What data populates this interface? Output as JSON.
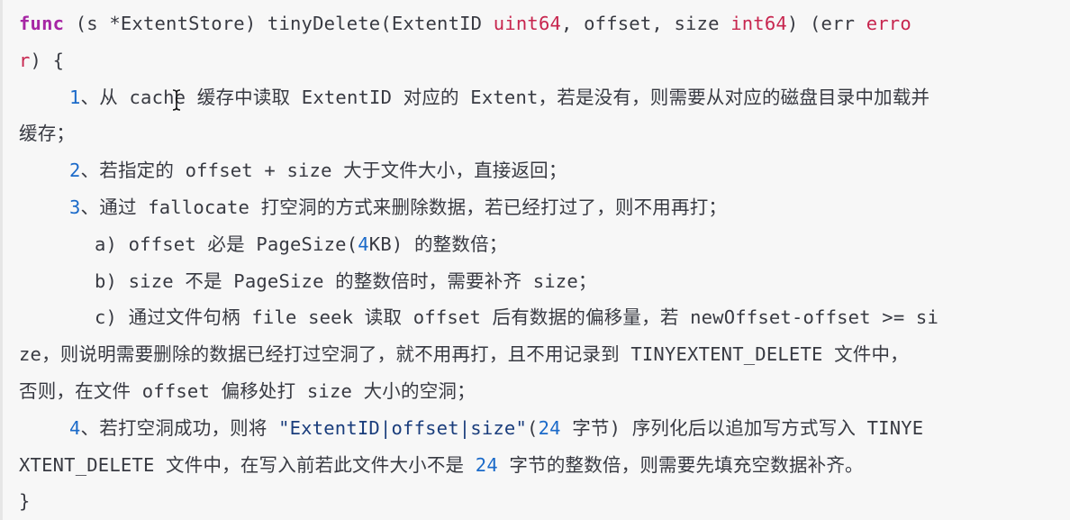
{
  "code": {
    "header": {
      "keyword": "func",
      "receiver": " (s *ExtentStore) tinyDelete(ExtentID ",
      "t1": "uint64",
      "mid1": ", offset, size ",
      "t2": "int64",
      "mid2": ") (err ",
      "t3": "erro"
    },
    "header_cont": {
      "t3_tail": "r",
      "rest": ") {"
    },
    "lines": [
      {
        "num": "1",
        "text": "、从 cache 缓存中读取 ExtentID 对应的 Extent，若是没有，则需要从对应的磁盘目录中加载并"
      },
      {
        "text": "缓存；"
      },
      {
        "num": "2",
        "text": "、若指定的 offset + size 大于文件大小，直接返回；"
      },
      {
        "num": "3",
        "text": "、通过 fallocate 打空洞的方式来删除数据，若已经打过了，则不用再打；"
      },
      {
        "pre": "a) offset 必是 PageSize(",
        "num": "4",
        "post": "KB) 的整数倍；"
      },
      {
        "text": "b) size 不是 PageSize 的整数倍时，需要补齐 size；"
      },
      {
        "text": "c) 通过文件句柄 file seek 读取 offset 后有数据的偏移量，若 newOffset-offset >= si"
      },
      {
        "text": "ze，则说明需要删除的数据已经打过空洞了，就不用再打，且不用记录到 TINYEXTENT_DELETE 文件中，"
      },
      {
        "text": "否则，在文件 offset 偏移处打 size 大小的空洞；"
      },
      {
        "num": "4",
        "pre": "、若打空洞成功，则将 ",
        "str": "\"ExtentID|offset|size\"",
        "paren": "(",
        "num2": "24",
        "post": " 字节) 序列化后以追加写方式写入 TINYE"
      },
      {
        "pre": "XTENT_DELETE 文件中，在写入前若此文件大小不是 ",
        "num": "24",
        "post": " 字节的整数倍，则需要先填充空数据补齐。"
      }
    ],
    "closing": "}"
  },
  "colors": {
    "background": "#f7f7f7",
    "text": "#383a42",
    "keyword": "#a626a4",
    "type": "#c7254e",
    "number": "#1b6ac9"
  },
  "icons": {
    "cursor": "text-cursor-icon"
  }
}
